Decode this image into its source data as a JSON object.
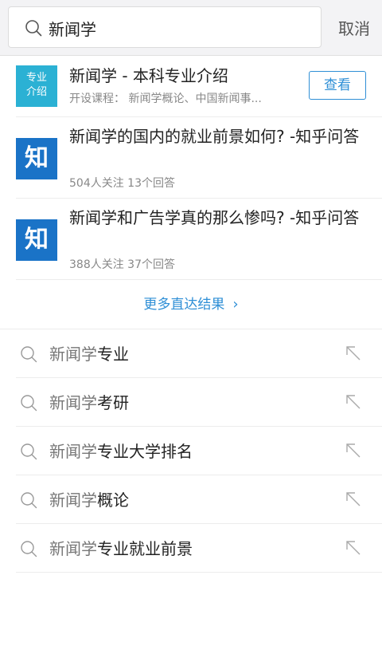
{
  "search": {
    "query": "新闻学",
    "cancel_label": "取消"
  },
  "direct_results": [
    {
      "badge": [
        "专业",
        "介绍"
      ],
      "title": "新闻学 - 本科专业介绍",
      "subtitle": "开设课程： 新闻学概论、中国新闻事...",
      "action_label": "查看"
    },
    {
      "badge_char": "知",
      "title": "新闻学的国内的就业前景如何? -知乎问答",
      "subtitle": "504人关注  13个回答"
    },
    {
      "badge_char": "知",
      "title": "新闻学和广告学真的那么惨吗? -知乎问答",
      "subtitle": "388人关注  37个回答"
    }
  ],
  "more_label": "更多直达结果",
  "suggestions": [
    {
      "highlight": "新闻学",
      "rest": "专业"
    },
    {
      "highlight": "新闻学",
      "rest": "考研"
    },
    {
      "highlight": "新闻学",
      "rest": "专业大学排名"
    },
    {
      "highlight": "新闻学",
      "rest": "概论"
    },
    {
      "highlight": "新闻学",
      "rest": "专业就业前景"
    }
  ],
  "colors": {
    "accent": "#2f8fd6",
    "major_badge": "#2bb1d4",
    "zhihu_badge": "#1a73c7"
  },
  "icons": {
    "search": "search-icon",
    "chevron": "chevron-right-icon",
    "fill_query": "arrow-up-left-icon"
  }
}
